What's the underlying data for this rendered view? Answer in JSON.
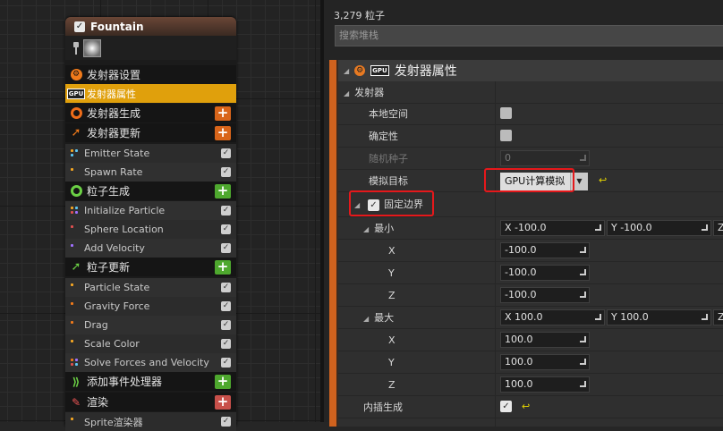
{
  "node": {
    "title": "Fountain",
    "rows": [
      {
        "label": "发射器设置",
        "kind": "section",
        "icon": "emitter-settings-icon"
      },
      {
        "label": "发射器属性",
        "kind": "selected",
        "icon": "gpu-icon"
      },
      {
        "label": "发射器生成",
        "kind": "section",
        "icon": "emitter-spawn-icon",
        "add": "+"
      },
      {
        "label": "发射器更新",
        "kind": "section",
        "icon": "emitter-update-icon",
        "add": "+"
      },
      {
        "label": "Emitter State",
        "kind": "module",
        "check": "✓"
      },
      {
        "label": "Spawn Rate",
        "kind": "module",
        "check": "✓"
      },
      {
        "label": "粒子生成",
        "kind": "section",
        "icon": "particle-spawn-icon",
        "add": "+"
      },
      {
        "label": "Initialize Particle",
        "kind": "module",
        "check": "✓"
      },
      {
        "label": "Sphere Location",
        "kind": "module",
        "check": "✓"
      },
      {
        "label": "Add Velocity",
        "kind": "module",
        "check": "✓"
      },
      {
        "label": "粒子更新",
        "kind": "section",
        "icon": "particle-update-icon",
        "add": "+"
      },
      {
        "label": "Particle State",
        "kind": "module",
        "check": "✓"
      },
      {
        "label": "Gravity Force",
        "kind": "module",
        "check": "✓"
      },
      {
        "label": "Drag",
        "kind": "module",
        "check": "✓"
      },
      {
        "label": "Scale Color",
        "kind": "module",
        "check": "✓"
      },
      {
        "label": "Solve Forces and Velocity",
        "kind": "module",
        "check": "✓"
      },
      {
        "label": "添加事件处理器",
        "kind": "section",
        "icon": "event-handler-icon",
        "add": "+"
      },
      {
        "label": "渲染",
        "kind": "section",
        "icon": "render-icon",
        "add": "+"
      },
      {
        "label": "Sprite渲染器",
        "kind": "module",
        "check": "✓"
      }
    ]
  },
  "details": {
    "count": "3,279 粒子",
    "search_placeholder": "搜索堆栈",
    "panel_title": "发射器属性",
    "category": "发射器",
    "local_space": "本地空间",
    "determinism": "确定性",
    "random_seed": "随机种子",
    "random_seed_value": "0",
    "sim_target": "模拟目标",
    "sim_target_value": "GPU计算模拟",
    "sim_target_arrow": "▼",
    "reset": "↩",
    "fixed_bounds": "固定边界",
    "min": "最小",
    "max": "最大",
    "x": "X",
    "y": "Y",
    "z": "Z",
    "min_x_inline": "X  -100.0",
    "min_y_inline": "Y  -100.0",
    "min_z_inline": "Z",
    "min_x": "-100.0",
    "min_y": "-100.0",
    "min_z": "-100.0",
    "max_x_inline": "X  100.0",
    "max_y_inline": "Y  100.0",
    "max_z_inline": "Z",
    "max_x": "100.0",
    "max_y": "100.0",
    "max_z": "100.0",
    "interp_spawn": "内插生成",
    "check": "✓",
    "gpu_badge": "GPU"
  }
}
